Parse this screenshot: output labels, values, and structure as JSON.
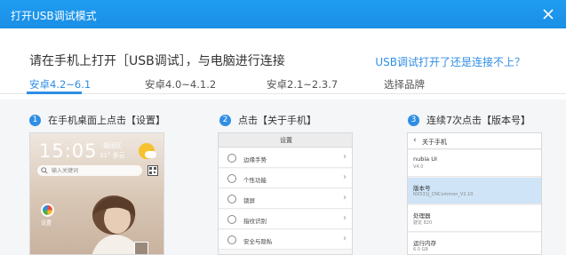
{
  "window": {
    "title": "打开USB调试模式",
    "close_icon": "close-icon"
  },
  "heading": "请在手机上打开［USB调试］，与电脑进行连接",
  "help_link": "USB调试打开了还是连接不上？",
  "tabs": [
    {
      "label": "安卓4.2~6.1",
      "active": true
    },
    {
      "label": "安卓4.0~4.1.2",
      "active": false
    },
    {
      "label": "安卓2.1~2.3.7",
      "active": false
    },
    {
      "label": "选择品牌",
      "active": false
    }
  ],
  "steps": [
    {
      "num": "1",
      "text": "在手机桌面上点击【设置】"
    },
    {
      "num": "2",
      "text": "点击【关于手机】"
    },
    {
      "num": "3",
      "text": "连续7次点击【版本号】"
    }
  ],
  "phone1": {
    "time": "15:05",
    "city": "福田区",
    "temp": "31° 多云",
    "search_placeholder": "输入关键词",
    "app_label": "设置"
  },
  "phone2": {
    "title": "设置",
    "rows": [
      "边缘手势",
      "个性功能",
      "锁屏",
      "指纹识别",
      "安全与隐私"
    ]
  },
  "phone3": {
    "title": "关于手机",
    "items": [
      {
        "key": "nubia UI",
        "value": "V4.0"
      },
      {
        "key": "版本号",
        "value": "NX531J_CNCommon_V2.10"
      },
      {
        "key": "处理器",
        "value": "骁龙 820"
      },
      {
        "key": "运行内存",
        "value": "6.0 GB"
      }
    ]
  },
  "colors": {
    "accent": "#2f8ee5",
    "titlebar": "#1f9cf0",
    "highlight": "#cfe4f7"
  }
}
